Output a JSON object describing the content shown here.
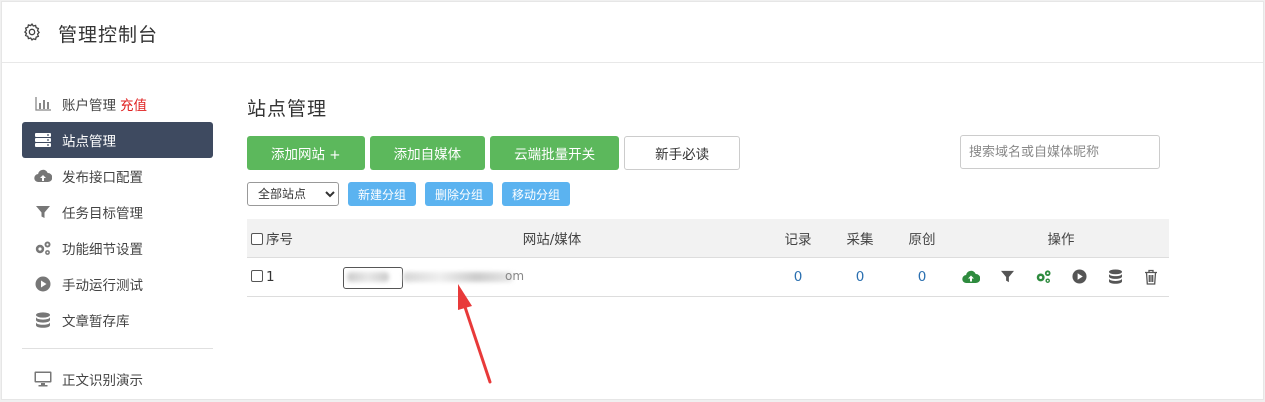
{
  "header": {
    "title": "管理控制台",
    "icon": "gear-icon"
  },
  "sidebar": {
    "items": [
      {
        "label": "账户管理",
        "extra": "充值",
        "icon": "bar-chart-icon",
        "active": false
      },
      {
        "label": "站点管理",
        "icon": "server-icon",
        "active": true
      },
      {
        "label": "发布接口配置",
        "icon": "cloud-upload-icon",
        "active": false
      },
      {
        "label": "任务目标管理",
        "icon": "filter-icon",
        "active": false
      },
      {
        "label": "功能细节设置",
        "icon": "gears-icon",
        "active": false
      },
      {
        "label": "手动运行测试",
        "icon": "play-circle-icon",
        "active": false
      },
      {
        "label": "文章暂存库",
        "icon": "database-icon",
        "active": false
      }
    ],
    "bottom_item": {
      "label": "正文识别演示",
      "icon": "monitor-icon"
    }
  },
  "main": {
    "title": "站点管理",
    "buttons": {
      "add_site": "添加网站 +",
      "add_media": "添加自媒体",
      "cloud_batch": "云端批量开关",
      "newbie": "新手必读"
    },
    "search": {
      "placeholder": "搜索域名或自媒体昵称",
      "value": ""
    },
    "group_select": {
      "selected": "全部站点"
    },
    "group_buttons": {
      "new": "新建分组",
      "delete": "删除分组",
      "move": "移动分组"
    },
    "table": {
      "headers": {
        "seq": "序号",
        "site": "网站/媒体",
        "records": "记录",
        "collect": "采集",
        "original": "原创",
        "ops": "操作"
      },
      "rows": [
        {
          "seq": "1",
          "site_tail": "om",
          "records": "0",
          "collect": "0",
          "original": "0"
        }
      ]
    }
  },
  "colors": {
    "sidebar_active": "#3e4a60",
    "green": "#5cb85c",
    "blue_btn": "#5bb3f0",
    "recharge": "#e02020",
    "arrow": "#e83a3a"
  }
}
